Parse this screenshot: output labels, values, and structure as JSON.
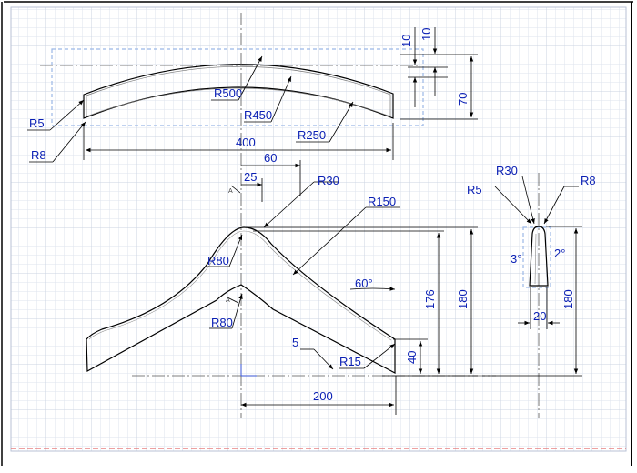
{
  "drawing": {
    "colors": {
      "grid": "#dde3ee",
      "grid_major": "#c9d1e0",
      "line": "#000000",
      "dim_text": "#0a1fb4",
      "hidden": "#9bb7e6",
      "border_red": "#e46a6a"
    },
    "top_view": {
      "radii": [
        "R5",
        "R8",
        "R500",
        "R450",
        "R250"
      ],
      "width": "400",
      "height": "70",
      "offset_a": "10",
      "offset_b": "10"
    },
    "front_view": {
      "radii": [
        "R30",
        "R150",
        "R80",
        "R80",
        "R15"
      ],
      "top_width": "25",
      "shoulder": "60",
      "angle": "60°",
      "chamfer": "5",
      "h176": "176",
      "h180": "180",
      "h40": "40",
      "half_width": "200",
      "tag_a": "A"
    },
    "side_view": {
      "radii": [
        "R30",
        "R5",
        "R8"
      ],
      "angle_left": "3°",
      "angle_right": "2°",
      "width": "20",
      "height": "180"
    }
  }
}
